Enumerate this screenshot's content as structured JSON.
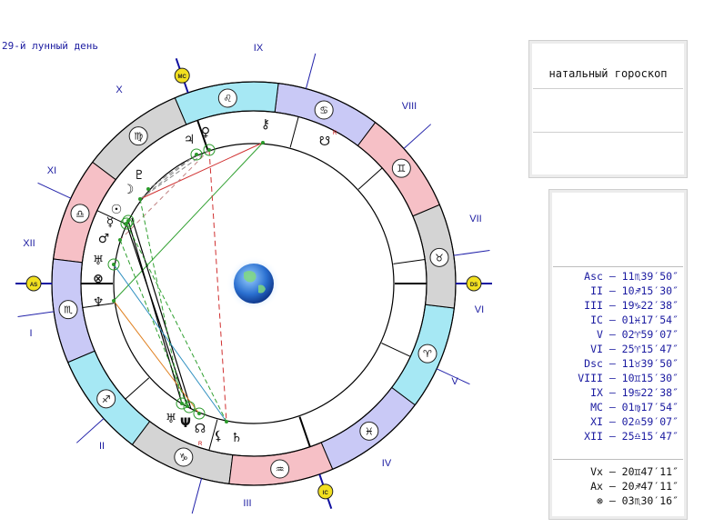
{
  "lunar_day": "29-й лунный день",
  "panel_title": "натальный гороскоп",
  "house_numbers": [
    "I",
    "II",
    "III",
    "IV",
    "V",
    "VI",
    "VII",
    "VIII",
    "IX",
    "X",
    "XI",
    "XII"
  ],
  "axis_labels": {
    "asc": "AS",
    "dsc": "DS",
    "mc": "MC",
    "ic": "IC"
  },
  "zodiac_signs": [
    "♈",
    "♉",
    "♊",
    "♋",
    "♌",
    "♍",
    "♎",
    "♏",
    "♐",
    "♑",
    "♒",
    "♓"
  ],
  "planets": [
    {
      "name": "jupiter",
      "glyph": "♃"
    },
    {
      "name": "venus",
      "glyph": "♀"
    },
    {
      "name": "chiron",
      "glyph": "⚷"
    },
    {
      "name": "lilith",
      "glyph": "☋"
    },
    {
      "name": "pluto",
      "glyph": "♇"
    },
    {
      "name": "moon",
      "glyph": "☽"
    },
    {
      "name": "sun",
      "glyph": "☉"
    },
    {
      "name": "mercury",
      "glyph": "☿"
    },
    {
      "name": "mars",
      "glyph": "♂"
    },
    {
      "name": "uranus",
      "glyph": "♅"
    },
    {
      "name": "fortune",
      "glyph": "⊗"
    },
    {
      "name": "neptune_l",
      "glyph": "♆"
    },
    {
      "name": "vertex",
      "glyph": "♅"
    },
    {
      "name": "neptune",
      "glyph": "Ψ"
    },
    {
      "name": "node",
      "glyph": "☊"
    },
    {
      "name": "fortuna",
      "glyph": "⚸"
    },
    {
      "name": "saturn",
      "glyph": "♄"
    }
  ],
  "retro_mark": "R",
  "positions": [
    "Asc – 11♏39′50″",
    "II – 10♐15′30″",
    "III – 19♑22′38″",
    "IC – 01♓17′54″",
    "V – 02♈59′07″",
    "VI – 25♈15′47″",
    "Dsc – 11♉39′50″",
    "VIII – 10♊15′30″",
    "IX – 19♋22′38″",
    "MC – 01♍17′54″",
    "XI – 02♎59′07″",
    "XII – 25♎15′47″"
  ],
  "points": [
    "Vx – 20♊47′11″",
    "Ax – 20♐47′11″",
    "⊗ – 03♏30′16″"
  ]
}
